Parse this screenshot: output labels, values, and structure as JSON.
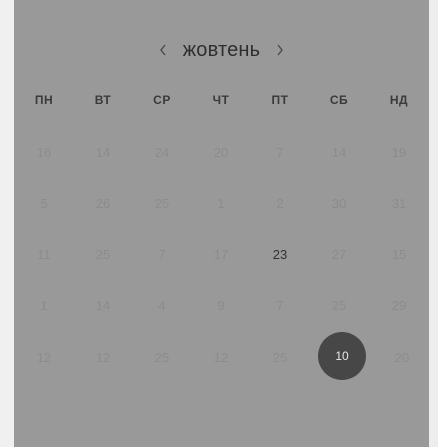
{
  "calendar": {
    "month": "жовтень",
    "weekdays": [
      "ПН",
      "ВТ",
      "СР",
      "ЧТ",
      "ПТ",
      "СБ",
      "НД"
    ],
    "rows": [
      [
        "16",
        "14",
        "24",
        "20",
        "7",
        "14",
        "19"
      ],
      [
        "5",
        "26",
        "25",
        "1",
        "2",
        "30",
        "31"
      ],
      [
        "11",
        "25",
        "7",
        "17",
        "23",
        "27",
        "15"
      ],
      [
        "1",
        "14",
        "4",
        "9",
        "7",
        "25",
        "29"
      ],
      [
        "12",
        "12",
        "25",
        "12",
        "25",
        "10",
        "20"
      ]
    ],
    "selected_day": "10",
    "highlighted_day": "23"
  },
  "colors": {
    "panel_bg": "#999999",
    "selected_bg": "#474747"
  },
  "icons": {
    "prev": "chevron-left-icon",
    "next": "chevron-right-icon"
  }
}
